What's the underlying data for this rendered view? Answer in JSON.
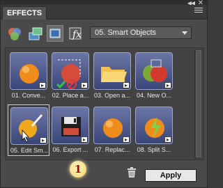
{
  "panel": {
    "tab_label": "EFFECTS",
    "menu_icon": "panel-menu-icon"
  },
  "toolbar": {
    "buttons": [
      {
        "name": "filters-icon"
      },
      {
        "name": "layer-styles-icon"
      },
      {
        "name": "photo-effects-icon"
      },
      {
        "name": "show-all-icon"
      }
    ],
    "dropdown_value": "05. Smart Objects"
  },
  "effects": {
    "items": [
      {
        "label": "01. Conve..."
      },
      {
        "label": "02. Place a..."
      },
      {
        "label": "03. Open a..."
      },
      {
        "label": "04. New O..."
      },
      {
        "label": "05. Edit Sm..."
      },
      {
        "label": "06. Export ..."
      },
      {
        "label": "07. Replac..."
      },
      {
        "label": "08. Split S..."
      }
    ]
  },
  "footer": {
    "marker": "1",
    "apply_label": "Apply"
  },
  "colors": {
    "panel_bg": "#4a4a4a",
    "thumb_blue": "#4e5a8e",
    "marker_yellow": "#f3d16a",
    "marker_red": "#b50000"
  }
}
